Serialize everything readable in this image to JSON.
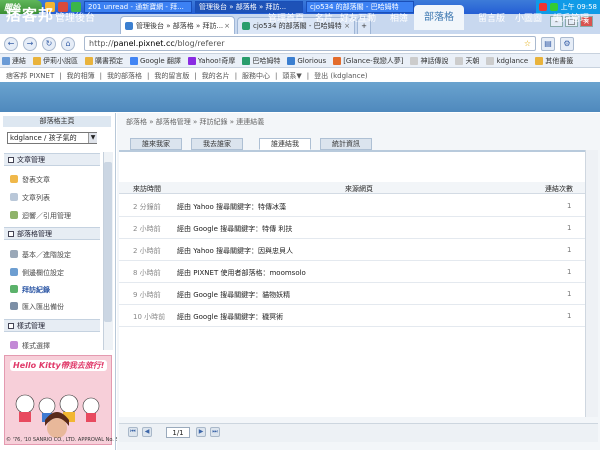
{
  "taskbar": {
    "start_label": "開始",
    "tasks": [
      "201 unread - 通新寶網 - 拜...",
      "管理後台 » 部落格 » 拜訪...",
      "cjo534 的部落閣 - 巴哈姆特"
    ],
    "clock": "上午 09:58"
  },
  "browser": {
    "tabs": [
      "管理後台 » 部落格 » 拜訪...",
      "cjo534 的部落閣 - 巴哈姆特"
    ],
    "url_scheme": "http://",
    "url_host": "panel.pixnet.cc",
    "url_path": "/blog/referer"
  },
  "bookmarks": [
    "連結",
    "伊莉小說區",
    "購書預定",
    "Google 翻譯",
    "Yahoo!奇摩",
    "巴哈姆特",
    "Glorious",
    "[Glance-我戀人夢]",
    "神話傳說",
    "天朝",
    "kdglance",
    "其他書籤"
  ],
  "site_top": [
    "痞客邦 PIXNET",
    "我的相簿",
    "我的部落格",
    "我的留言版",
    "我的名片",
    "服務中心",
    "頭系▼",
    "登出 (kdglance)"
  ],
  "header": {
    "logo": "痞客邦",
    "subtitle": "管理後台",
    "nav": [
      "管理首頁",
      "名片",
      "好友互動",
      "相簿",
      "部落格",
      "留言版",
      "小圖圖",
      "帳戶管理"
    ],
    "active_nav": "部落格"
  },
  "sidebar": {
    "title": "部落格主頁",
    "blog_select": "kdglance / 孩子氣的",
    "sections": [
      {
        "title": "文章管理",
        "items": [
          "發表文章",
          "文章列表",
          "迴響／引用管理"
        ]
      },
      {
        "title": "部落格管理",
        "items": [
          "基本／進階設定",
          "側邊欄位設定",
          "拜訪紀錄",
          "匯入匯出備份"
        ]
      },
      {
        "title": "樣式管理",
        "items": [
          "樣式選擇"
        ]
      }
    ],
    "active_item": "拜訪紀錄",
    "ad_title": "Hello Kitty帶我去旅行!",
    "ad_copy": "© '76, '10 SANRIO CO., LTD. APPROVAL No. S503224"
  },
  "main": {
    "breadcrumb": [
      "部落格",
      "部落格管理",
      "拜訪紀錄",
      "連連結義"
    ],
    "tabs": [
      "誰來我家",
      "我去誰家",
      "誰連結我",
      "統計資訊"
    ],
    "active_tab": "誰連結我",
    "columns": [
      "來訪時間",
      "來源網頁",
      "連結次數"
    ],
    "rows": [
      {
        "time": "2 分鐘前",
        "source": "經由 Yahoo 搜尋關鍵字：特傳冰藻",
        "count": "1"
      },
      {
        "time": "2 小時前",
        "source": "經由 Google 搜尋關鍵字：特傳 利扶",
        "count": "1"
      },
      {
        "time": "2 小時前",
        "source": "經由 Yahoo 搜尋關鍵字：因與忠貝人",
        "count": "1"
      },
      {
        "time": "8 小時前",
        "source": "經由 PIXNET 使用者部落格：moomsolo",
        "count": "1"
      },
      {
        "time": "9 小時前",
        "source": "經由 Google 搜尋關鍵字：貓物妖精",
        "count": "1"
      },
      {
        "time": "10 小時前",
        "source": "經由 Google 搜尋關鍵字：穢冥術",
        "count": "1"
      }
    ],
    "pager": {
      "page": "1",
      "total_label": "/1"
    }
  },
  "colors": {
    "header_blue": "#5b95c6",
    "link_blue": "#2a55a4",
    "accent_pink": "#e03a6a"
  }
}
